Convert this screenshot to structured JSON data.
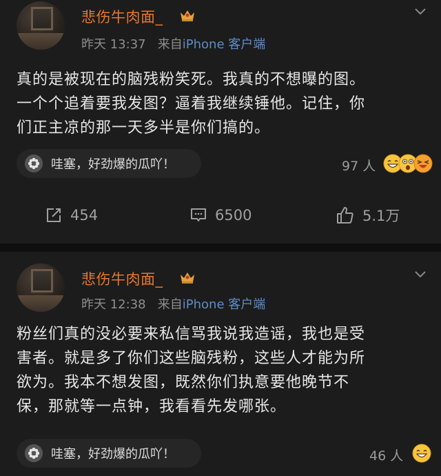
{
  "posts": [
    {
      "username": "悲伤牛肉面_",
      "time": "昨天 13:37",
      "source_prefix": "来自",
      "source": "iPhone 客户端",
      "content_lines": [
        "真的是被现在的脑残粉笑死。我真的不想曝的图。",
        "一个个追着要我发图？逼着我继续锤他。记住，你",
        "们正主凉的那一天多半是你们搞的。"
      ],
      "reaction_text": "哇塞，好劲爆的瓜吖！",
      "reaction_count": "97 人",
      "reaction_emojis": [
        "grin-emoji",
        "shocked-emoji",
        "laugh-emoji"
      ],
      "shares": "454",
      "comments": "6500",
      "likes": "5.1万"
    },
    {
      "username": "悲伤牛肉面_",
      "time": "昨天 12:38",
      "source_prefix": "来自",
      "source": "iPhone 客户端",
      "content_lines": [
        "粉丝们真的没必要来私信骂我说我造谣，我也是受",
        "害者。就是多了你们这些脑残粉，这些人才能为所",
        "欲为。我本不想发图，既然你们执意要他晚节不",
        "保，那就等一点钟，我看看先发哪张。"
      ],
      "reaction_text": "哇塞，好劲爆的瓜吖！",
      "reaction_count": "46 人",
      "reaction_emojis": [
        "grin-emoji"
      ]
    }
  ],
  "colors": {
    "background": "#0f0f0f",
    "card": "#1c1c1c",
    "username": "#e9772b",
    "source_link": "#5f8dc7",
    "meta": "#8e8e8e",
    "pill": "#262626"
  }
}
